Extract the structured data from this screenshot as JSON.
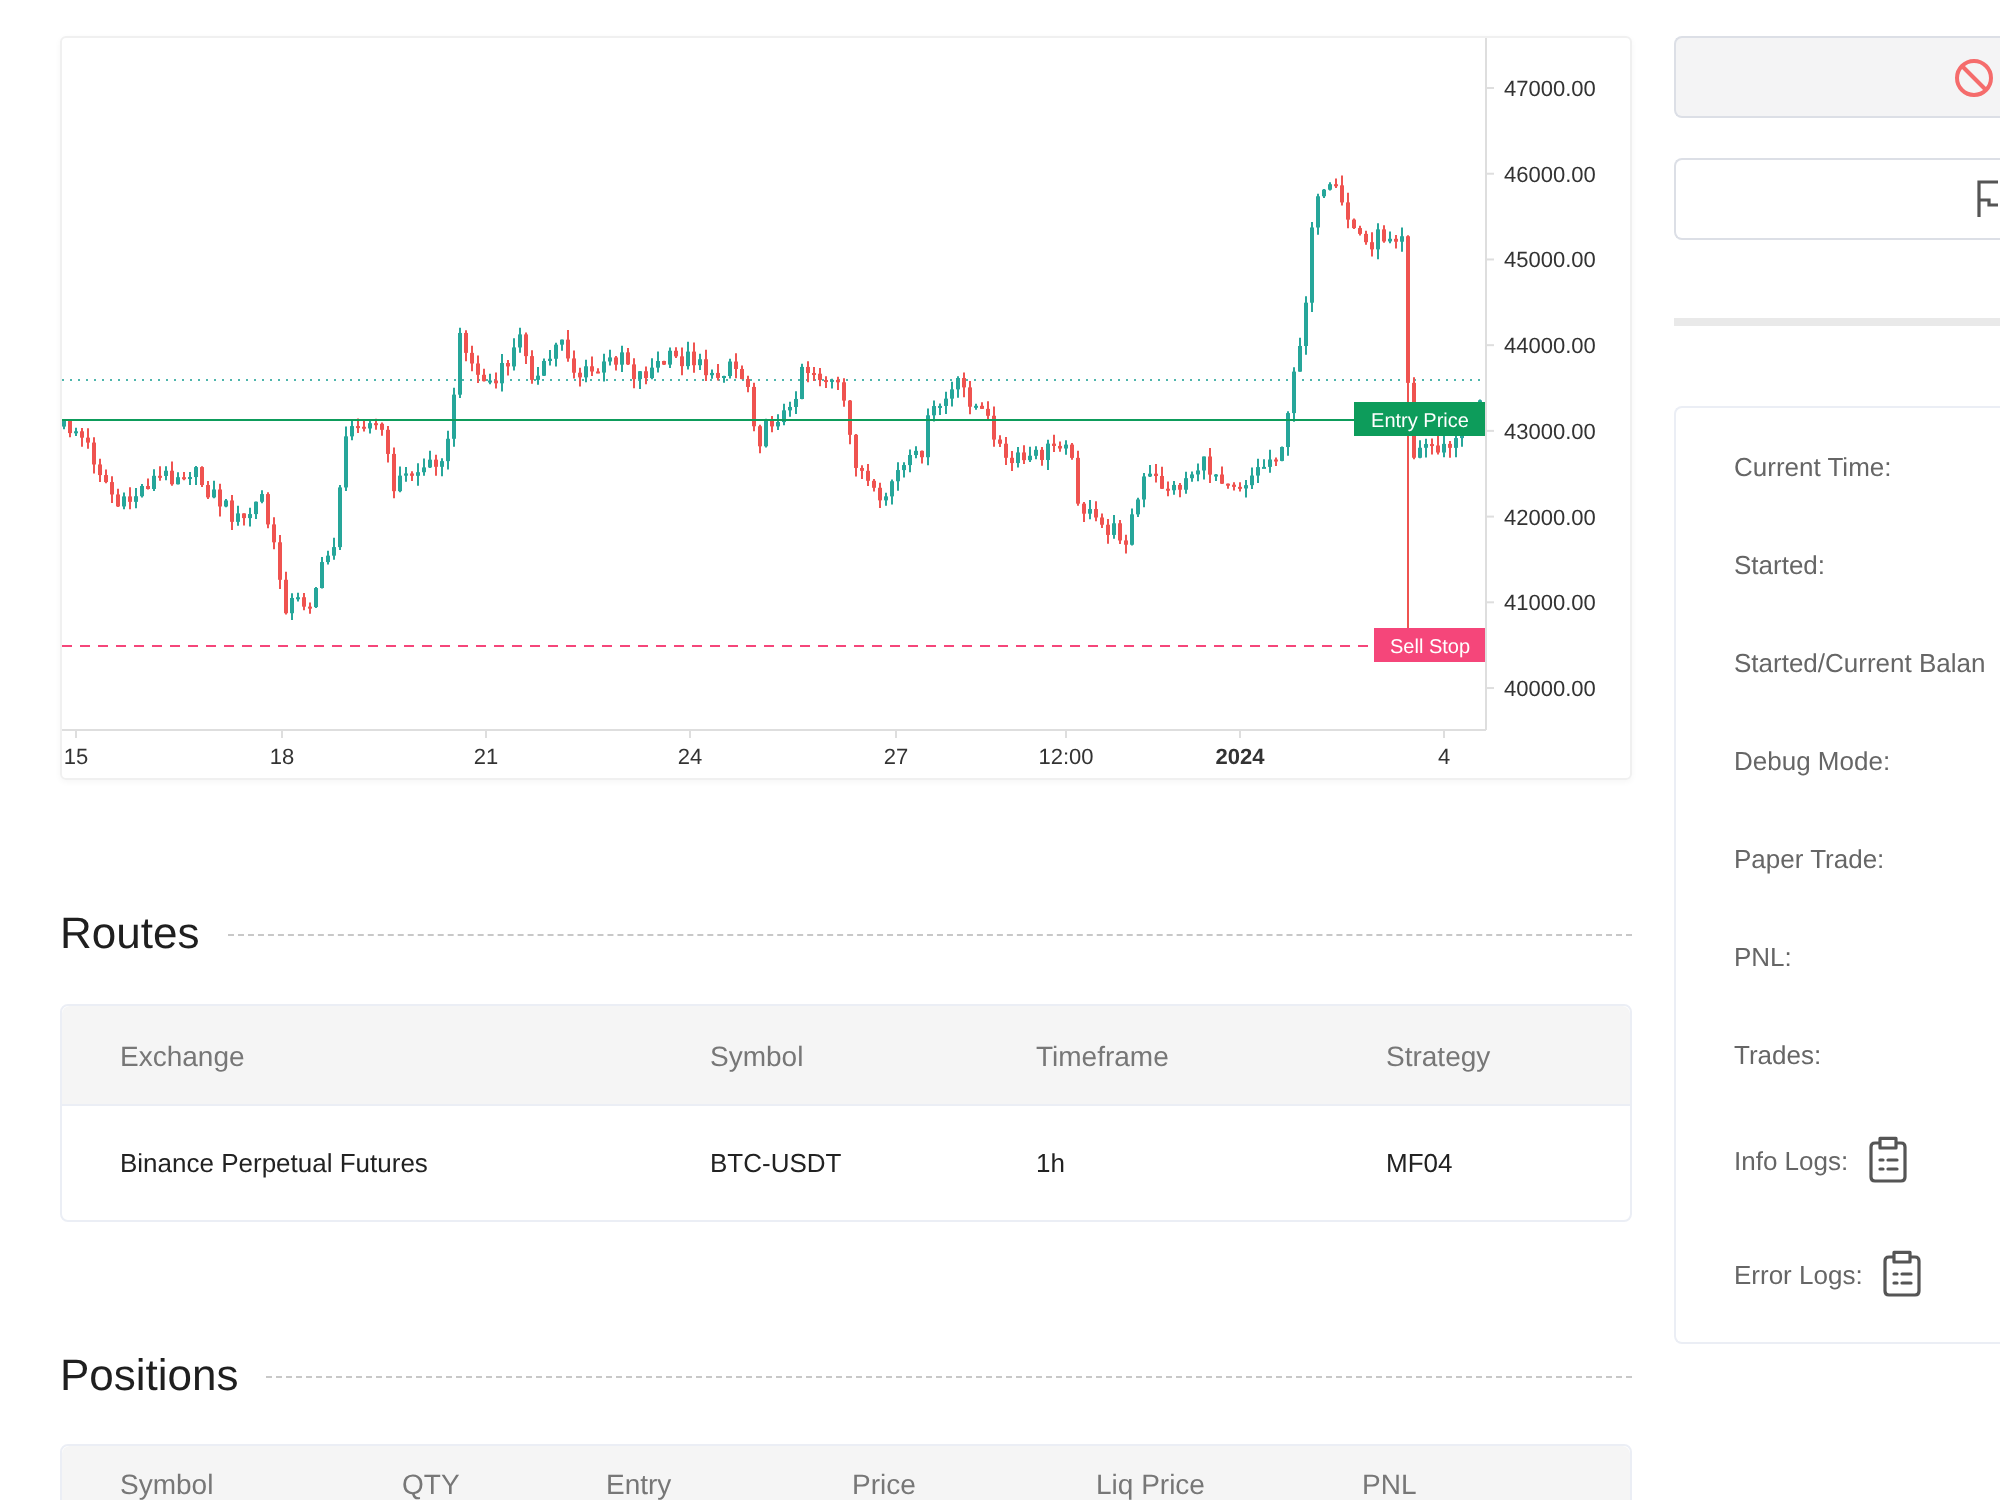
{
  "chart": {
    "price_ticks": [
      "47000.00",
      "46000.00",
      "45000.00",
      "44000.00",
      "43000.00",
      "42000.00",
      "41000.00",
      "40000.00"
    ],
    "time_ticks": [
      {
        "label": "15",
        "kind": "day"
      },
      {
        "label": "18",
        "kind": "day"
      },
      {
        "label": "21",
        "kind": "day"
      },
      {
        "label": "24",
        "kind": "day"
      },
      {
        "label": "27",
        "kind": "day"
      },
      {
        "label": "12:00",
        "kind": "time"
      },
      {
        "label": "2024",
        "kind": "year"
      },
      {
        "label": "4",
        "kind": "day"
      }
    ],
    "markers": [
      {
        "label": "Entry Price",
        "kind": "entry"
      },
      {
        "label": "Sell Stop",
        "kind": "stop"
      }
    ]
  },
  "routes": {
    "title": "Routes",
    "columns": [
      "Exchange",
      "Symbol",
      "Timeframe",
      "Strategy"
    ],
    "rows": [
      [
        "Binance Perpetual Futures",
        "BTC-USDT",
        "1h",
        "MF04"
      ]
    ]
  },
  "positions": {
    "title": "Positions",
    "columns": [
      "Symbol",
      "QTY",
      "Entry",
      "Price",
      "Liq Price",
      "PNL"
    ]
  },
  "actions": [
    {
      "kind": "cancel"
    },
    {
      "kind": "flag"
    }
  ],
  "status_panel": {
    "items": [
      {
        "label": "Current Time:",
        "kind": "text"
      },
      {
        "label": "Started:",
        "kind": "text"
      },
      {
        "label": "Started/Current Balan",
        "kind": "text"
      },
      {
        "label": "Debug Mode:",
        "kind": "text"
      },
      {
        "label": "Paper Trade:",
        "kind": "text"
      },
      {
        "label": "PNL:",
        "kind": "text"
      },
      {
        "label": "Trades:",
        "kind": "text"
      },
      {
        "label": "Info Logs:",
        "kind": "log"
      },
      {
        "label": "Error Logs:",
        "kind": "log"
      }
    ]
  }
}
